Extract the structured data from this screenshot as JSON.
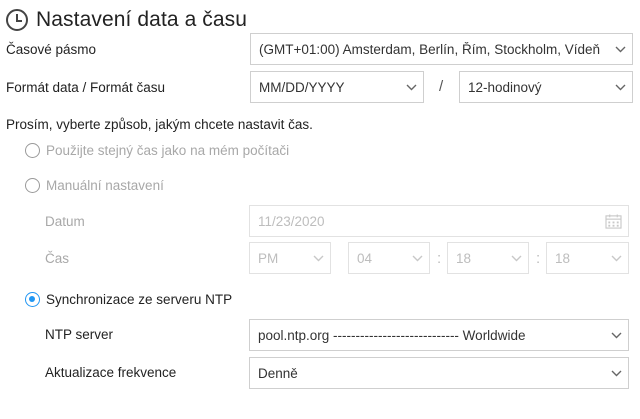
{
  "title": "Nastavení data a času",
  "timezone": {
    "label": "Časové pásmo",
    "value": "(GMT+01:00) Amsterdam, Berlín, Řím, Stockholm, Vídeň"
  },
  "format": {
    "label": "Formát data / Formát času",
    "date_value": "MM/DD/YYYY",
    "separator": "/",
    "time_value": "12-hodinový"
  },
  "prompt": "Prosím, vyberte způsob, jakým chcete nastavit čas.",
  "options": {
    "same_as_pc": {
      "label": "Použijte stejný čas jako na mém počítači",
      "selected": false
    },
    "manual": {
      "label": "Manuální nastavení",
      "selected": false
    },
    "ntp": {
      "label": "Synchronizace ze serveru NTP",
      "selected": true
    }
  },
  "manual": {
    "date_label": "Datum",
    "date_value": "11/23/2020",
    "time_label": "Čas",
    "ampm": "PM",
    "hour": "04",
    "minute": "18",
    "second": "18",
    "time_sep": ":"
  },
  "ntp": {
    "server_label": "NTP server",
    "server_value": "pool.ntp.org ---------------------------- Worldwide",
    "frequency_label": "Aktualizace frekvence",
    "frequency_value": "Denně"
  },
  "colors": {
    "accent": "#2196f3",
    "disabled_text": "#a8a8a8",
    "border": "#cfcfcf"
  }
}
